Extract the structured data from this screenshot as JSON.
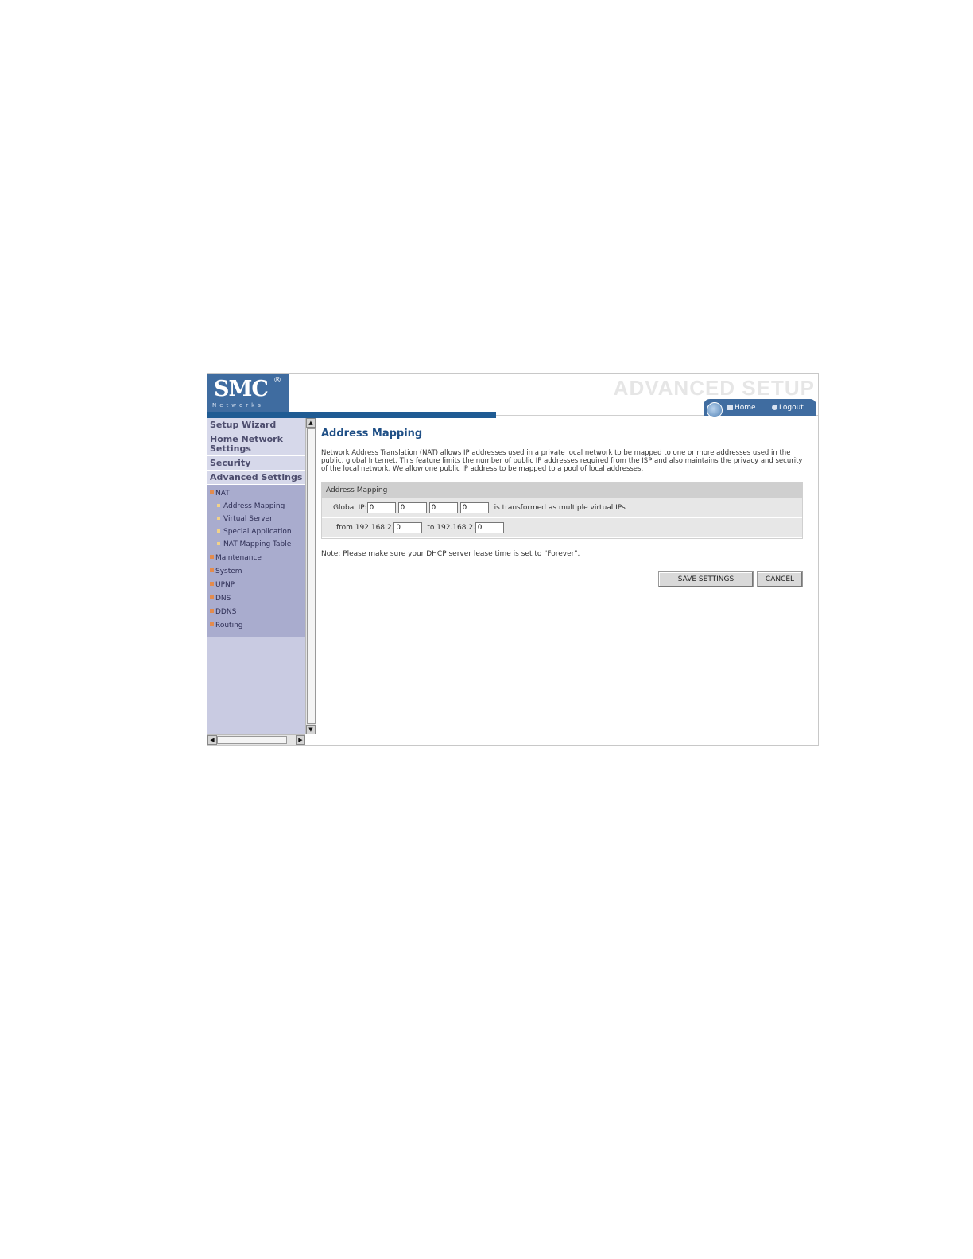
{
  "header": {
    "logo_text": "SMC",
    "logo_reg": "®",
    "logo_sub": "Networks",
    "advanced_title": "ADVANCED SETUP",
    "home_link": "Home",
    "logout_link": "Logout"
  },
  "sidebar": {
    "main_items": [
      "Setup Wizard",
      "Home Network Settings",
      "Security",
      "Advanced Settings"
    ],
    "nat": "NAT",
    "nat_sub": [
      "Address Mapping",
      "Virtual Server",
      "Special Application",
      "NAT Mapping Table"
    ],
    "other_items": [
      "Maintenance",
      "System",
      "UPNP",
      "DNS",
      "DDNS",
      "Routing"
    ]
  },
  "content": {
    "title": "Address Mapping",
    "description": "Network Address Translation (NAT) allows IP addresses used in a private local network to be mapped to one or more addresses used in the public, global Internet. This feature limits the number of public IP addresses required from the ISP and also maintains the privacy and security of the local network. We allow one public IP address to be mapped to a pool of local addresses.",
    "table_header": "Address Mapping",
    "global_ip_label": "Global IP:",
    "global_ip_values": [
      "0",
      "0",
      "0",
      "0"
    ],
    "virtual_text": "is transformed as multiple virtual IPs",
    "from_label": "from 192.168.2.",
    "from_value": "0",
    "to_label": "to 192.168.2.",
    "to_value": "0",
    "note": "Note: Please make sure your DHCP server lease time is set to \"Forever\".",
    "save_label": "SAVE SETTINGS",
    "cancel_label": "CANCEL"
  },
  "colors": {
    "brand_blue": "#3f6ca0",
    "bar_blue": "#1f5b93",
    "sidebar_bg": "#c9cbe2",
    "title_blue": "#1f4f86"
  }
}
